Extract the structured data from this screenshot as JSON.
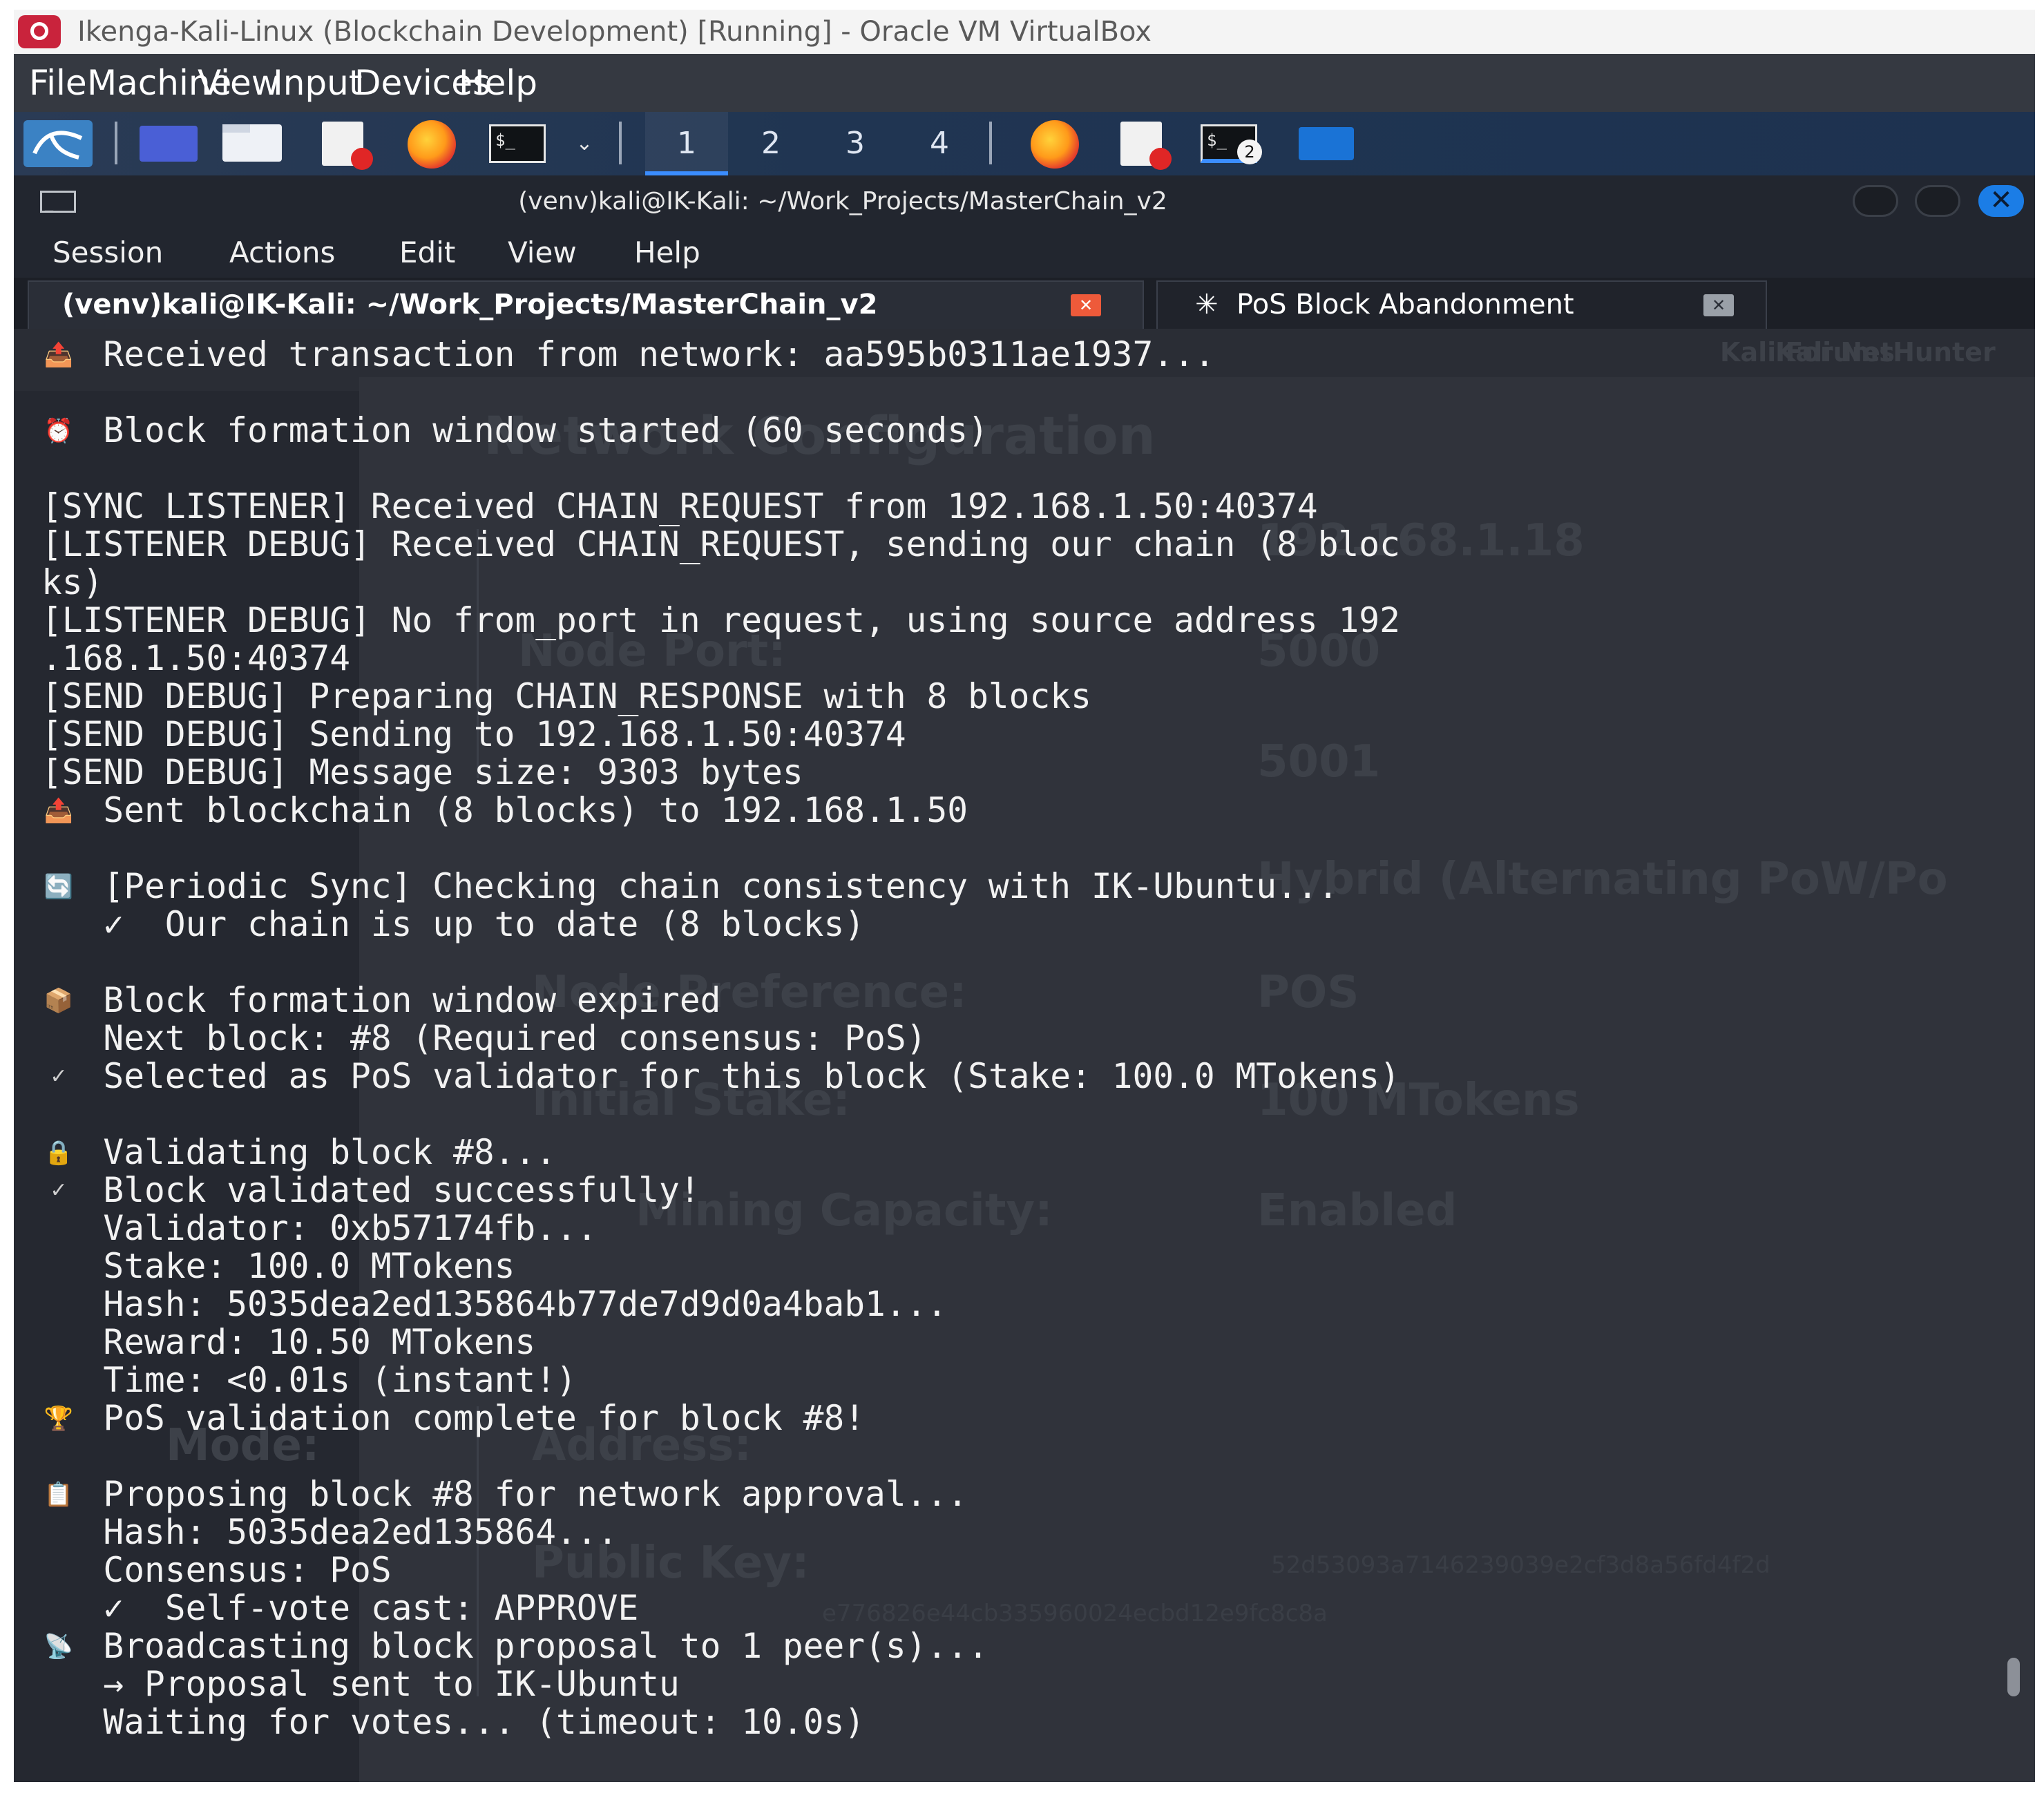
{
  "vbox": {
    "window_title": "Ikenga-Kali-Linux (Blockchain Development) [Running] - Oracle VM VirtualBox",
    "menu": [
      "File",
      "Machine",
      "View",
      "Input",
      "Devices",
      "Help"
    ]
  },
  "panel": {
    "workspaces": [
      "1",
      "2",
      "3",
      "4"
    ],
    "active_workspace": "1",
    "terminal_badge": "2",
    "icons": [
      "kali-menu-icon",
      "show-desktop-icon",
      "file-manager-icon",
      "text-editor-icon",
      "firefox-icon",
      "terminal-icon",
      "firefox-icon",
      "document-icon",
      "terminal-icon",
      "folder-icon"
    ]
  },
  "terminal": {
    "title": "(venv)kali@IK-Kali: ~/Work_Projects/MasterChain_v2",
    "menu": [
      "Session",
      "Actions",
      "Edit",
      "View",
      "Help"
    ],
    "tabs": [
      {
        "label": "(venv)kali@IK-Kali: ~/Work_Projects/MasterChain_v2"
      },
      {
        "label": "PoS Block Abandonment"
      }
    ],
    "lines": [
      {
        "icon": "📤",
        "text": "   Received transaction from network: aa595b0311ae1937..."
      },
      {
        "icon": "",
        "text": ""
      },
      {
        "icon": "⏰",
        "text": "   Block formation window started (60 seconds)"
      },
      {
        "icon": "",
        "text": ""
      },
      {
        "icon": "",
        "text": "[SYNC LISTENER] Received CHAIN_REQUEST from 192.168.1.50:40374"
      },
      {
        "icon": "",
        "text": "[LISTENER DEBUG] Received CHAIN_REQUEST, sending our chain (8 bloc"
      },
      {
        "icon": "",
        "text": "ks)"
      },
      {
        "icon": "",
        "text": "[LISTENER DEBUG] No from_port in request, using source address 192"
      },
      {
        "icon": "",
        "text": ".168.1.50:40374"
      },
      {
        "icon": "",
        "text": "[SEND DEBUG] Preparing CHAIN_RESPONSE with 8 blocks"
      },
      {
        "icon": "",
        "text": "[SEND DEBUG] Sending to 192.168.1.50:40374"
      },
      {
        "icon": "",
        "text": "[SEND DEBUG] Message size: 9303 bytes"
      },
      {
        "icon": "📤",
        "text": "   Sent blockchain (8 blocks) to 192.168.1.50"
      },
      {
        "icon": "",
        "text": ""
      },
      {
        "icon": "🔄",
        "text": "   [Periodic Sync] Checking chain consistency with IK-Ubuntu..."
      },
      {
        "icon": "",
        "text": "   ✓  Our chain is up to date (8 blocks)"
      },
      {
        "icon": "",
        "text": ""
      },
      {
        "icon": "📦",
        "text": "   Block formation window expired"
      },
      {
        "icon": "",
        "text": "   Next block: #8 (Required consensus: PoS)"
      },
      {
        "icon": "✓",
        "text": "   Selected as PoS validator for this block (Stake: 100.0 MTokens)"
      },
      {
        "icon": "",
        "text": ""
      },
      {
        "icon": "🔒",
        "text": "   Validating block #8..."
      },
      {
        "icon": "✓",
        "text": "   Block validated successfully!"
      },
      {
        "icon": "",
        "text": "   Validator: 0xb57174fb..."
      },
      {
        "icon": "",
        "text": "   Stake: 100.0 MTokens"
      },
      {
        "icon": "",
        "text": "   Hash: 5035dea2ed135864b77de7d9d0a4bab1..."
      },
      {
        "icon": "",
        "text": "   Reward: 10.50 MTokens"
      },
      {
        "icon": "",
        "text": "   Time: <0.01s (instant!)"
      },
      {
        "icon": "🏆",
        "text": "   PoS validation complete for block #8!"
      },
      {
        "icon": "",
        "text": ""
      },
      {
        "icon": "📋",
        "text": "   Proposing block #8 for network approval..."
      },
      {
        "icon": "",
        "text": "   Hash: 5035dea2ed135864..."
      },
      {
        "icon": "",
        "text": "   Consensus: PoS"
      },
      {
        "icon": "",
        "text": "   ✓  Self-vote cast: APPROVE"
      },
      {
        "icon": "📡",
        "text": "   Broadcasting block proposal to 1 peer(s)..."
      },
      {
        "icon": "",
        "text": "   → Proposal sent to IK-Ubuntu"
      },
      {
        "icon": "",
        "text": "   Waiting for votes... (timeout: 10.0s)"
      }
    ]
  },
  "background_window": {
    "heading": "Network Configuration",
    "labels": [
      "Node Port:",
      "Node Preference:",
      "Initial Stake:",
      "Mining Capacity:",
      "Mode:",
      "Address:",
      "Public Key:"
    ],
    "values": [
      "192.168.1.18",
      "5000",
      "5001",
      "Hybrid (Alternating PoW/Po",
      "POS",
      "100 MTokens",
      "Enabled"
    ],
    "keys": [
      "52d53093a7146239039e2cf3d8a56fd4f2d",
      "e776826e44cb335960024ecbd12e9fc8c8a"
    ],
    "tabs": [
      "Kali Forums",
      "Kali NetHunter"
    ]
  },
  "colors": {
    "terminal_bg": "#2a2d35",
    "terminal_text": "#f2f2f2",
    "accent": "#1b7de6",
    "vbox_menubar": "#353941"
  }
}
